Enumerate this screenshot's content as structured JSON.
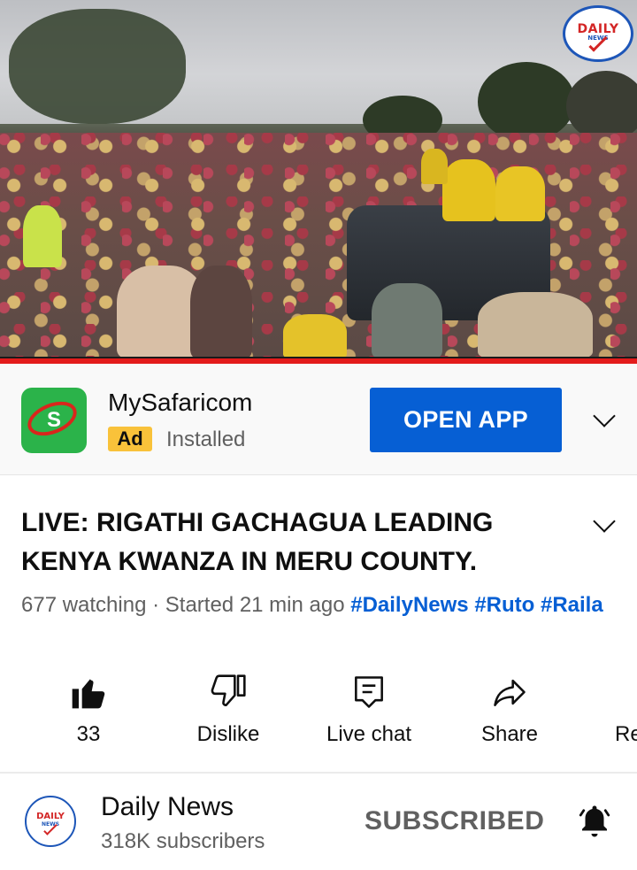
{
  "video": {
    "watermark": {
      "word": "DAILY",
      "sub": "NEWS"
    }
  },
  "ad": {
    "app_name": "MySafaricom",
    "icon_letter": "S",
    "badge": "Ad",
    "status": "Installed",
    "button_label": "OPEN APP"
  },
  "title": "LIVE: RIGATHI GACHAGUA LEADING KENYA KWANZA IN MERU COUNTY.",
  "meta": {
    "watching": "677 watching",
    "separator": " · ",
    "started": "Started 21 min ago",
    "tags": [
      "#DailyNews",
      "#Ruto",
      "#Raila"
    ]
  },
  "actions": {
    "like": "33",
    "dislike": "Dislike",
    "live_chat": "Live chat",
    "share": "Share",
    "more": "Re"
  },
  "channel": {
    "name": "Daily News",
    "subscribers": "318K subscribers",
    "subscribe_state": "SUBSCRIBED",
    "avatar": {
      "word": "DAILY",
      "sub": "NEWS"
    }
  },
  "colors": {
    "accent_blue": "#065fd4",
    "live_red": "#e31b1b",
    "ad_yellow": "#f9c23a",
    "safaricom_green": "#2bb34a",
    "secondary_text": "#606060"
  },
  "icons": [
    "thumbs-up-icon",
    "thumbs-down-icon",
    "chat-icon",
    "share-icon",
    "chevron-down-icon",
    "bell-icon"
  ]
}
